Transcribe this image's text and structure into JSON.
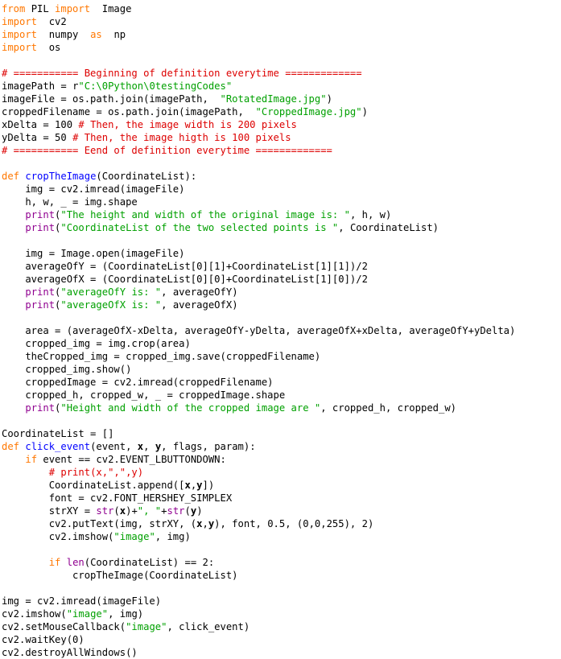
{
  "editor": {
    "title": "Python Code Listing",
    "language": "Python",
    "background_color": "#ffffff",
    "font_size_px": 12.2,
    "line_height_px": 16,
    "tab_width_spaces": 4
  },
  "syntax_colors": {
    "plain": "#000000",
    "keyword": "#ff7700",
    "string": "#00a000",
    "comment": "#dd0000",
    "definition_name": "#0000ff",
    "builtin": "#900090",
    "parameter": "#000000"
  },
  "code": {
    "lines": [
      [
        {
          "t": "keyword",
          "s": "from"
        },
        {
          "t": "plain",
          "s": " PIL "
        },
        {
          "t": "keyword",
          "s": "import"
        },
        {
          "t": "plain",
          "s": "  Image"
        }
      ],
      [
        {
          "t": "keyword",
          "s": "import"
        },
        {
          "t": "plain",
          "s": "  cv2"
        }
      ],
      [
        {
          "t": "keyword",
          "s": "import"
        },
        {
          "t": "plain",
          "s": "  numpy  "
        },
        {
          "t": "keyword",
          "s": "as"
        },
        {
          "t": "plain",
          "s": "  np"
        }
      ],
      [
        {
          "t": "keyword",
          "s": "import"
        },
        {
          "t": "plain",
          "s": "  os"
        }
      ],
      [],
      [
        {
          "t": "comment",
          "s": "# =========== Beginning of definition everytime ============="
        }
      ],
      [
        {
          "t": "plain",
          "s": "imagePath = "
        },
        {
          "t": "plain",
          "s": "r"
        },
        {
          "t": "string",
          "s": "\"C:\\0Python\\0testingCodes\""
        }
      ],
      [
        {
          "t": "plain",
          "s": "imageFile = os.path.join(imagePath,  "
        },
        {
          "t": "string",
          "s": "\"RotatedImage.jpg\""
        },
        {
          "t": "plain",
          "s": ")"
        }
      ],
      [
        {
          "t": "plain",
          "s": "croppedFilename = os.path.join(imagePath,  "
        },
        {
          "t": "string",
          "s": "\"CroppedImage.jpg\""
        },
        {
          "t": "plain",
          "s": ")"
        }
      ],
      [
        {
          "t": "plain",
          "s": "xDelta = 100 "
        },
        {
          "t": "comment",
          "s": "# Then, the image width is 200 pixels"
        }
      ],
      [
        {
          "t": "plain",
          "s": "yDelta = 50 "
        },
        {
          "t": "comment",
          "s": "# Then, the image higth is 100 pixels"
        }
      ],
      [
        {
          "t": "comment",
          "s": "# =========== Eend of definition everytime ============="
        }
      ],
      [],
      [
        {
          "t": "keyword",
          "s": "def"
        },
        {
          "t": "plain",
          "s": " "
        },
        {
          "t": "defname",
          "s": "cropTheImage"
        },
        {
          "t": "plain",
          "s": "(CoordinateList):"
        }
      ],
      [
        {
          "t": "plain",
          "s": "    img = cv2.imread(imageFile)"
        }
      ],
      [
        {
          "t": "plain",
          "s": "    h, w, _ = img.shape"
        }
      ],
      [
        {
          "t": "plain",
          "s": "    "
        },
        {
          "t": "builtin",
          "s": "print"
        },
        {
          "t": "plain",
          "s": "("
        },
        {
          "t": "string",
          "s": "\"The height and width of the original image is: \""
        },
        {
          "t": "plain",
          "s": ", h, w)"
        }
      ],
      [
        {
          "t": "plain",
          "s": "    "
        },
        {
          "t": "builtin",
          "s": "print"
        },
        {
          "t": "plain",
          "s": "("
        },
        {
          "t": "string",
          "s": "\"CoordinateList of the two selected points is \""
        },
        {
          "t": "plain",
          "s": ", CoordinateList)"
        }
      ],
      [],
      [
        {
          "t": "plain",
          "s": "    img = Image.open(imageFile)"
        }
      ],
      [
        {
          "t": "plain",
          "s": "    averageOfY = (CoordinateList[0][1]+CoordinateList[1][1])/2"
        }
      ],
      [
        {
          "t": "plain",
          "s": "    averageOfX = (CoordinateList[0][0]+CoordinateList[1][0])/2"
        }
      ],
      [
        {
          "t": "plain",
          "s": "    "
        },
        {
          "t": "builtin",
          "s": "print"
        },
        {
          "t": "plain",
          "s": "("
        },
        {
          "t": "string",
          "s": "\"averageOfY is: \""
        },
        {
          "t": "plain",
          "s": ", averageOfY)"
        }
      ],
      [
        {
          "t": "plain",
          "s": "    "
        },
        {
          "t": "builtin",
          "s": "print"
        },
        {
          "t": "plain",
          "s": "("
        },
        {
          "t": "string",
          "s": "\"averageOfX is: \""
        },
        {
          "t": "plain",
          "s": ", averageOfX)"
        }
      ],
      [],
      [
        {
          "t": "plain",
          "s": "    area = (averageOfX-xDelta, averageOfY-yDelta, averageOfX+xDelta, averageOfY+yDelta)"
        }
      ],
      [
        {
          "t": "plain",
          "s": "    cropped_img = img.crop(area)"
        }
      ],
      [
        {
          "t": "plain",
          "s": "    theCropped_img = cropped_img.save(croppedFilename)"
        }
      ],
      [
        {
          "t": "plain",
          "s": "    cropped_img.show()"
        }
      ],
      [
        {
          "t": "plain",
          "s": "    croppedImage = cv2.imread(croppedFilename)"
        }
      ],
      [
        {
          "t": "plain",
          "s": "    cropped_h, cropped_w, _ = croppedImage.shape"
        }
      ],
      [
        {
          "t": "plain",
          "s": "    "
        },
        {
          "t": "builtin",
          "s": "print"
        },
        {
          "t": "plain",
          "s": "("
        },
        {
          "t": "string",
          "s": "\"Height and width of the cropped image are \""
        },
        {
          "t": "plain",
          "s": ", cropped_h, cropped_w)"
        }
      ],
      [],
      [
        {
          "t": "plain",
          "s": "CoordinateList = []"
        }
      ],
      [
        {
          "t": "keyword",
          "s": "def"
        },
        {
          "t": "plain",
          "s": " "
        },
        {
          "t": "defname",
          "s": "click_event"
        },
        {
          "t": "plain",
          "s": "(event, "
        },
        {
          "t": "param",
          "s": "x"
        },
        {
          "t": "plain",
          "s": ", "
        },
        {
          "t": "param",
          "s": "y"
        },
        {
          "t": "plain",
          "s": ", flags, param):"
        }
      ],
      [
        {
          "t": "plain",
          "s": "    "
        },
        {
          "t": "keyword",
          "s": "if"
        },
        {
          "t": "plain",
          "s": " event == cv2.EVENT_LBUTTONDOWN:"
        }
      ],
      [
        {
          "t": "plain",
          "s": "        "
        },
        {
          "t": "comment",
          "s": "# print(x,\",\",y)"
        }
      ],
      [
        {
          "t": "plain",
          "s": "        CoordinateList.append(["
        },
        {
          "t": "param",
          "s": "x"
        },
        {
          "t": "plain",
          "s": ","
        },
        {
          "t": "param",
          "s": "y"
        },
        {
          "t": "plain",
          "s": "])"
        }
      ],
      [
        {
          "t": "plain",
          "s": "        font = cv2.FONT_HERSHEY_SIMPLEX"
        }
      ],
      [
        {
          "t": "plain",
          "s": "        strXY = "
        },
        {
          "t": "builtin",
          "s": "str"
        },
        {
          "t": "plain",
          "s": "("
        },
        {
          "t": "param",
          "s": "x"
        },
        {
          "t": "plain",
          "s": ")+"
        },
        {
          "t": "string",
          "s": "\", \""
        },
        {
          "t": "plain",
          "s": "+"
        },
        {
          "t": "builtin",
          "s": "str"
        },
        {
          "t": "plain",
          "s": "("
        },
        {
          "t": "param",
          "s": "y"
        },
        {
          "t": "plain",
          "s": ")"
        }
      ],
      [
        {
          "t": "plain",
          "s": "        cv2.putText(img, strXY, ("
        },
        {
          "t": "param",
          "s": "x"
        },
        {
          "t": "plain",
          "s": ","
        },
        {
          "t": "param",
          "s": "y"
        },
        {
          "t": "plain",
          "s": "), font, 0.5, (0,0,255), 2)"
        }
      ],
      [
        {
          "t": "plain",
          "s": "        cv2.imshow("
        },
        {
          "t": "string",
          "s": "\"image\""
        },
        {
          "t": "plain",
          "s": ", img)"
        }
      ],
      [],
      [
        {
          "t": "plain",
          "s": "        "
        },
        {
          "t": "keyword",
          "s": "if"
        },
        {
          "t": "plain",
          "s": " "
        },
        {
          "t": "builtin",
          "s": "len"
        },
        {
          "t": "plain",
          "s": "(CoordinateList) == 2:"
        }
      ],
      [
        {
          "t": "plain",
          "s": "            cropTheImage(CoordinateList)"
        }
      ],
      [],
      [
        {
          "t": "plain",
          "s": "img = cv2.imread(imageFile)"
        }
      ],
      [
        {
          "t": "plain",
          "s": "cv2.imshow("
        },
        {
          "t": "string",
          "s": "\"image\""
        },
        {
          "t": "plain",
          "s": ", img)"
        }
      ],
      [
        {
          "t": "plain",
          "s": "cv2.setMouseCallback("
        },
        {
          "t": "string",
          "s": "\"image\""
        },
        {
          "t": "plain",
          "s": ", click_event)"
        }
      ],
      [
        {
          "t": "plain",
          "s": "cv2.waitKey(0)"
        }
      ],
      [
        {
          "t": "plain",
          "s": "cv2.destroyAllWindows()"
        }
      ]
    ]
  }
}
